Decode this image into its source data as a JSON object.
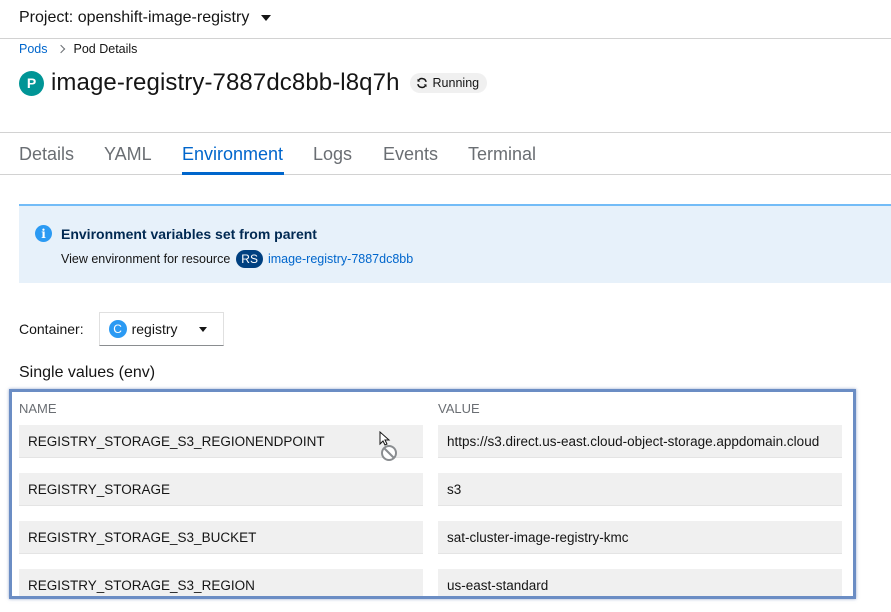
{
  "project": {
    "label": "Project: openshift-image-registry"
  },
  "breadcrumb": {
    "parent": "Pods",
    "current": "Pod Details"
  },
  "pod": {
    "badge": "P",
    "name": "image-registry-7887dc8bb-l8q7h",
    "status": "Running"
  },
  "tabs": [
    {
      "label": "Details"
    },
    {
      "label": "YAML"
    },
    {
      "label": "Environment"
    },
    {
      "label": "Logs"
    },
    {
      "label": "Events"
    },
    {
      "label": "Terminal"
    }
  ],
  "active_tab": "Environment",
  "alert": {
    "title": "Environment variables set from parent",
    "body": "View environment for resource",
    "resource_badge": "RS",
    "resource_link": "image-registry-7887dc8bb"
  },
  "container": {
    "label": "Container:",
    "badge": "C",
    "value": "registry"
  },
  "section": {
    "heading": "Single values (env)"
  },
  "table": {
    "name_header": "NAME",
    "value_header": "VALUE",
    "rows": [
      {
        "name": "REGISTRY_STORAGE_S3_REGIONENDPOINT",
        "value": "https://s3.direct.us-east.cloud-object-storage.appdomain.cloud"
      },
      {
        "name": "REGISTRY_STORAGE",
        "value": "s3"
      },
      {
        "name": "REGISTRY_STORAGE_S3_BUCKET",
        "value": "sat-cluster-image-registry-kmc"
      },
      {
        "name": "REGISTRY_STORAGE_S3_REGION",
        "value": "us-east-standard"
      }
    ]
  },
  "colors": {
    "link": "#0066cc",
    "pod_badge": "#009596",
    "alert_bg": "#e7f1fa",
    "rs_badge": "#004080",
    "container_badge": "#2b9af3",
    "highlight_border": "#6b8dc4"
  }
}
